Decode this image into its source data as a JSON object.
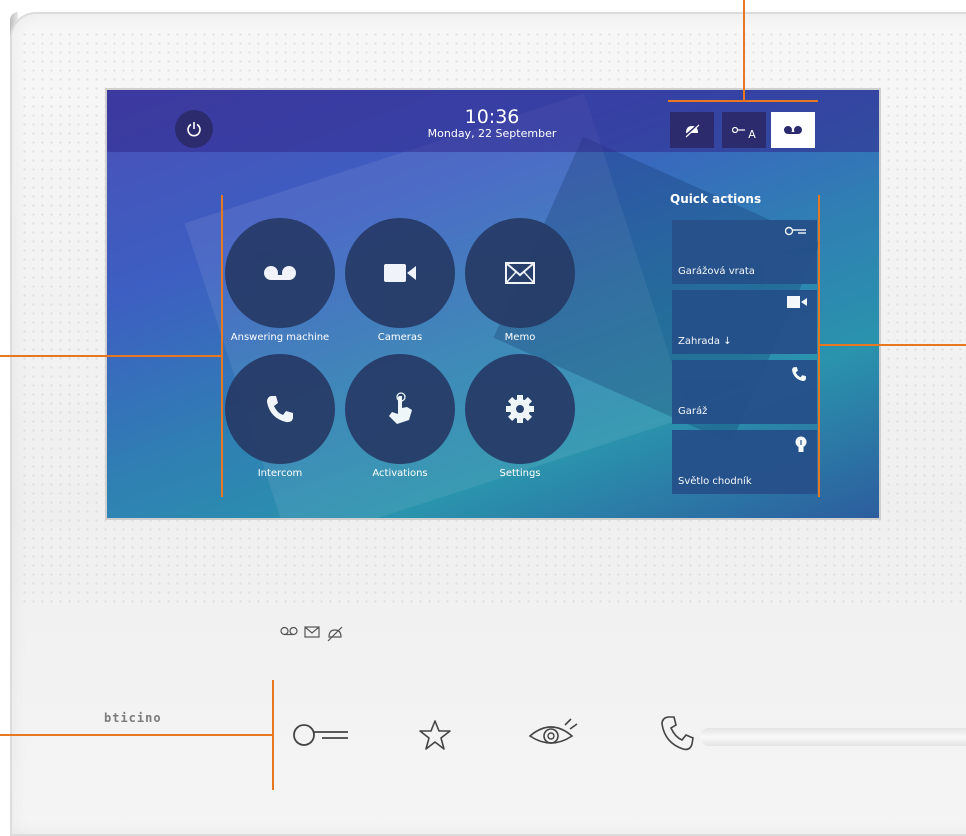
{
  "clock": {
    "time": "10:36",
    "date": "Monday, 22 September"
  },
  "status_buttons": [
    {
      "name": "ringtone-off-icon"
    },
    {
      "name": "door-lock-a-icon",
      "label": "A"
    },
    {
      "name": "answering-machine-icon"
    }
  ],
  "apps": [
    {
      "label": "Answering machine",
      "icon": "answering-machine-icon"
    },
    {
      "label": "Cameras",
      "icon": "camera-icon"
    },
    {
      "label": "Memo",
      "icon": "envelope-icon"
    },
    {
      "label": "Intercom",
      "icon": "phone-icon"
    },
    {
      "label": "Activations",
      "icon": "hand-tap-icon"
    },
    {
      "label": "Settings",
      "icon": "gear-icon"
    }
  ],
  "quick_actions": {
    "title": "Quick actions",
    "items": [
      {
        "label": "Garážová vrata",
        "icon": "key-icon"
      },
      {
        "label": "Zahrada ↓",
        "icon": "camera-icon"
      },
      {
        "label": "Garáž",
        "icon": "phone-icon"
      },
      {
        "label": "Světlo chodník",
        "icon": "light-bulb-icon"
      }
    ]
  },
  "brand": "bticino",
  "colors": {
    "callout": "#e87722",
    "screen_top": "#4a4fb7",
    "tile": "#263a66"
  }
}
